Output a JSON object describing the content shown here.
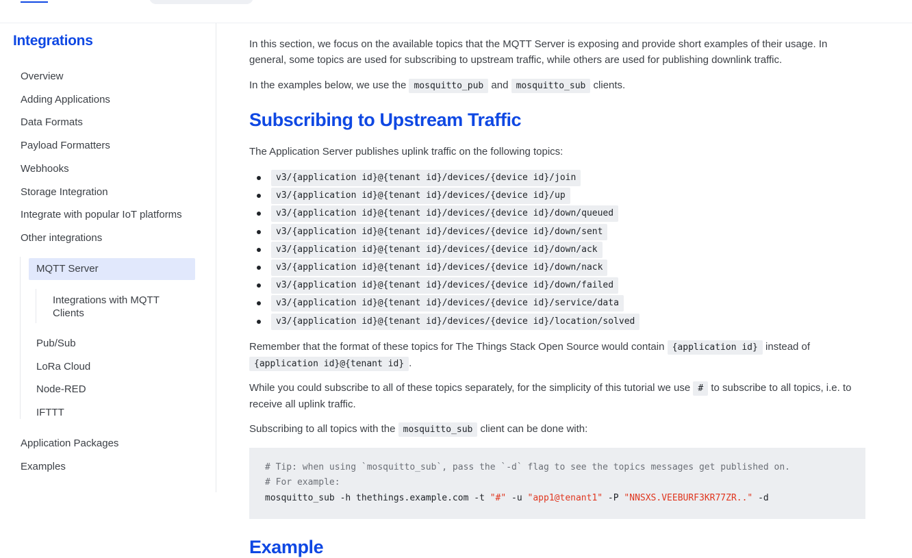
{
  "sidebar": {
    "title": "Integrations",
    "items": [
      {
        "label": "Overview"
      },
      {
        "label": "Adding Applications"
      },
      {
        "label": "Data Formats"
      },
      {
        "label": "Payload Formatters"
      },
      {
        "label": "Webhooks"
      },
      {
        "label": "Storage Integration"
      },
      {
        "label": "Integrate with popular IoT platforms"
      },
      {
        "label": "Other integrations"
      }
    ],
    "sub_items": [
      {
        "label": "MQTT Server",
        "active": true
      },
      {
        "label": "Pub/Sub"
      },
      {
        "label": "LoRa Cloud"
      },
      {
        "label": "Node-RED"
      },
      {
        "label": "IFTTT"
      }
    ],
    "subsub_item": {
      "line1": "Integrations with MQTT",
      "line2": "Clients"
    },
    "bottom_items": [
      {
        "label": "Application Packages"
      },
      {
        "label": "Examples"
      }
    ]
  },
  "content": {
    "intro": {
      "text1": "In this section, we focus on the available topics that the MQTT Server is exposing and provide short examples of their usage. In general, some topics are used for subscribing to upstream traffic, while others are used for publishing downlink traffic."
    },
    "examples_line": {
      "pre": "In the examples below, we use the",
      "code1": "mosquitto_pub",
      "mid": "and",
      "code2": "mosquitto_sub",
      "post": "clients."
    },
    "heading": "Subscribing to Upstream Traffic",
    "publishes_line": "The Application Server publishes uplink traffic on the following topics:",
    "topics": [
      "v3/{application id}@{tenant id}/devices/{device id}/join",
      "v3/{application id}@{tenant id}/devices/{device id}/up",
      "v3/{application id}@{tenant id}/devices/{device id}/down/queued",
      "v3/{application id}@{tenant id}/devices/{device id}/down/sent",
      "v3/{application id}@{tenant id}/devices/{device id}/down/ack",
      "v3/{application id}@{tenant id}/devices/{device id}/down/nack",
      "v3/{application id}@{tenant id}/devices/{device id}/down/failed",
      "v3/{application id}@{tenant id}/devices/{device id}/service/data",
      "v3/{application id}@{tenant id}/devices/{device id}/location/solved"
    ],
    "remember": {
      "pre": "Remember that the format of these topics for The Things Stack Open Source would contain",
      "code1": "{application id}",
      "mid": "instead of",
      "code2": "{application id}@{tenant id}",
      "post": "."
    },
    "while": {
      "pre": "While you could subscribe to all of these topics separately, for the simplicity of this tutorial we use",
      "code": "#",
      "post": "to subscribe to all topics, i.e. to receive all uplink traffic."
    },
    "subscribing": {
      "pre": "Subscribing to all topics with the",
      "code": "mosquitto_sub",
      "post": "client can be done with:"
    },
    "codeblock": {
      "comment1": "# Tip: when using `mosquitto_sub`, pass the `-d` flag to see the topics messages get published on.",
      "comment2": "# For example:",
      "cmd_a": "mosquitto_sub -h thethings.example.com -t ",
      "str1": "\"#\"",
      "cmd_b": " -u ",
      "str2": "\"app1@tenant1\"",
      "cmd_c": " -P ",
      "str3": "\"NNSXS.VEEBURF3KR77ZR..\"",
      "cmd_d": " -d"
    },
    "next_heading": "Example"
  }
}
